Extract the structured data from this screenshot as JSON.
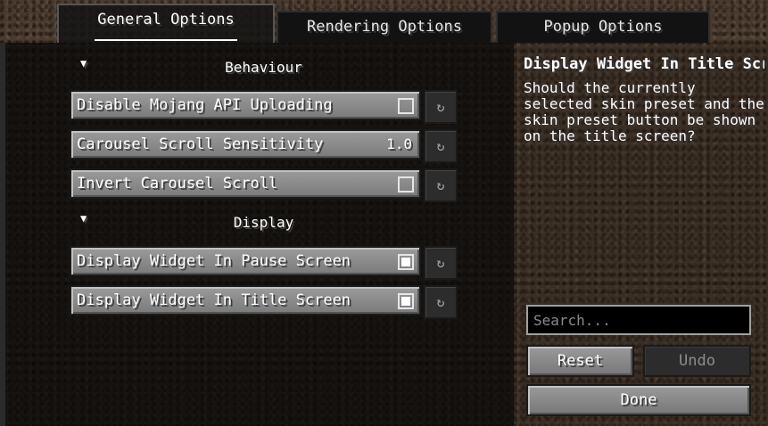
{
  "tabs": [
    {
      "label": "General Options",
      "active": true
    },
    {
      "label": "Rendering Options",
      "active": false
    },
    {
      "label": "Popup Options",
      "active": false
    }
  ],
  "sections": [
    {
      "title": "Behaviour",
      "arrow": "▼",
      "options": [
        {
          "label": "Disable Mojang API Uploading",
          "checked": false
        },
        {
          "label": "Carousel Scroll Sensitivity",
          "value": "1.0"
        },
        {
          "label": "Invert Carousel Scroll",
          "checked": false
        }
      ]
    },
    {
      "title": "Display",
      "arrow": "▼",
      "options": [
        {
          "label": "Display Widget In Pause Screen",
          "checked": true
        },
        {
          "label": "Display Widget In Title Screen",
          "checked": true
        }
      ]
    }
  ],
  "reset_icon": "↻",
  "sidebar": {
    "title": "Display Widget In Title Screen",
    "description": "Should the currently selected skin preset and the skin preset button be shown on the title screen?"
  },
  "search": {
    "placeholder": "Search..."
  },
  "buttons": {
    "reset": "Reset",
    "undo": "Undo",
    "done": "Done"
  },
  "colors": {
    "button_bg": "#8a8a8a",
    "panel_bg": "#0a0a0a",
    "text": "#ffffff"
  }
}
